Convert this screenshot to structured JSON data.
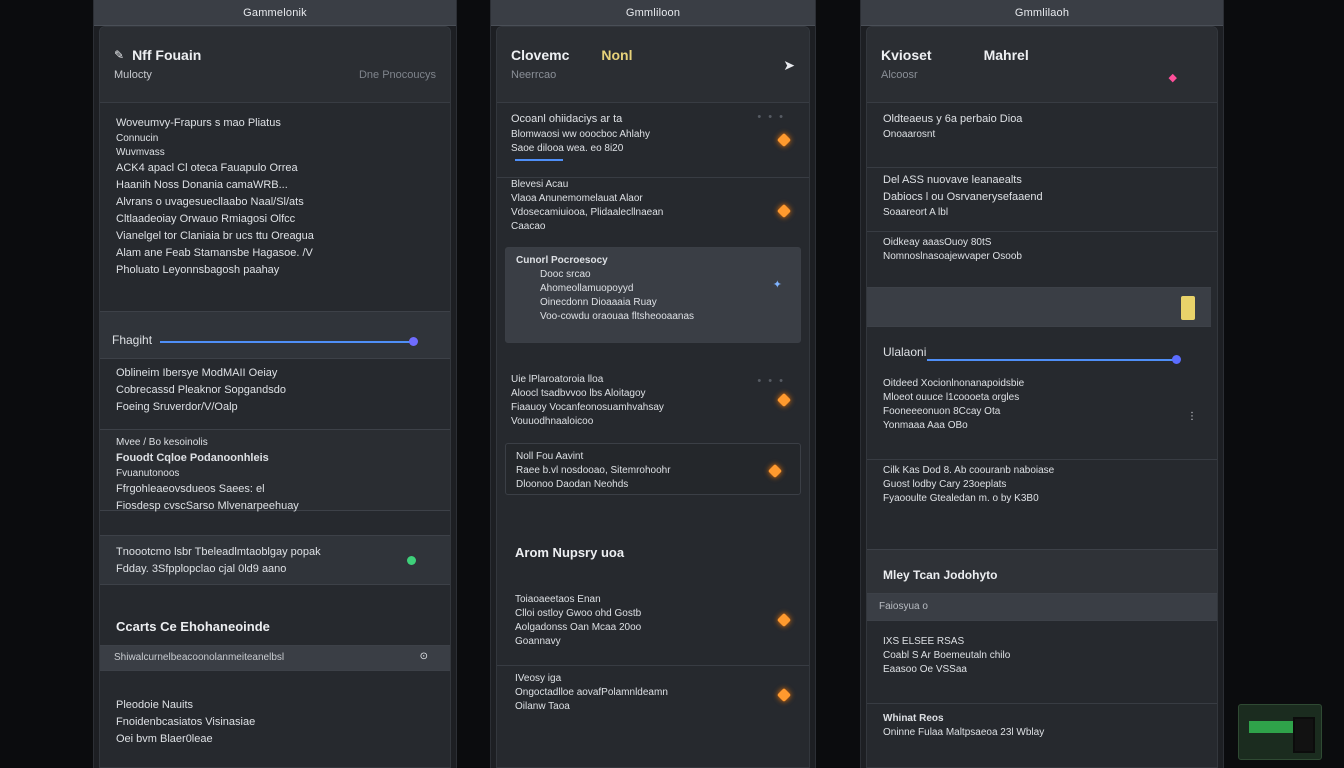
{
  "colors": {
    "bg": "#0b0c0e",
    "panel": "#26292e",
    "accent_blue": "#4f8ff7",
    "accent_green": "#8cf06a",
    "accent_orange": "#ff9a2e"
  },
  "col1": {
    "tab": "Gammelonik",
    "title": "Nff Fouain",
    "subtitle_left": "Mulocty",
    "subtitle_right": "Dne Pnocoucys",
    "block1": [
      "Woveumvy-Frapurs s mao Pliatus",
      "Connucin",
      "Wuvmvass",
      "ACK4 apacl Cl oteca Fauapulo Orrea",
      "Haanih Noss Donania camaWRB...",
      "Alvrans o uvagesuecllaabo Naal/Sl/ats",
      "Cltlaadeoiay Orwauo Rmiagosi Olfcc",
      "Vianelgel tor Claniaia br ucs ttu Oreagua",
      "Alam ane Feab Stamansbe Hagasoe. /V",
      "Pholuato Leyonnsbagosh paahay"
    ],
    "slider_label": "Fhagiht",
    "block2": [
      "Oblineim Ibersye ModMAII Oeiay",
      "Cobrecassd Pleaknor Sopgandsdo",
      "Foeing Sruverdor/V/Oalp"
    ],
    "block3_head": "Mvee / Bo kesoinolis",
    "block3_green": "Fouodt Cqloe Podanoonhleis",
    "block3": [
      "Fvuanutonoos",
      "Ffrgohleaeovsdueos Saees: el",
      "Fiosdesp cvscSarso Mlvenarpeehuay"
    ],
    "block4": [
      "Tnoootcmo lsbr Tbeleadlmtaoblgay popak",
      "Fdday. 3Sfpplopclao cjal 0ld9 aano"
    ],
    "section_title": "Ccarts Ce Ehohaneoinde",
    "search": "Shiwalcurnelbeacoonolanmeiteanelbsl",
    "footer": [
      "Pleodoie Nauits",
      "Fnoidenbcasiatos Visinasiae",
      "Oei bvm Blaer0leae"
    ]
  },
  "col2": {
    "tab": "Gmmliloon",
    "title": "Clovemc",
    "title_accent": "Nonl",
    "subtitle": "Neerrcao",
    "items": [
      {
        "l1": "Ocoanl ohiidaciys ar ta",
        "l2": "Blomwaosi ww ooocboc Ahlahy",
        "l3": "Saoe dilooa wea. eo 8i20"
      },
      {
        "l1": "Blevesi Acau",
        "l2": "Vlaoa Anunemomelauat Alaor",
        "l3": "Vdosecamiuiooa, Plidaalecllnaean",
        "l4": "Caacao"
      },
      {
        "l1": "Cunorl Pocroesocy",
        "l2": "Dooc srcao",
        "l3": "Ahomeollamuopoyyd",
        "l4": "Oinecdonn Dioaaaia Ruay",
        "l5": "Voo-cowdu oraouaa fltsheooaanas"
      },
      {
        "l1": "Uie lPlaroatoroia lloa",
        "l2": "Aloocl tsadbvvoo lbs Aloitagoy",
        "l3": "Fiaauoy Vocanfeonosuamhvahsay",
        "l4": "Vouuodhnaaloicoo"
      },
      {
        "l1": "Noll Fou Aavint",
        "l2": "Raee b.vl nosdooao, Sitemrohoohr",
        "l3": "Dloonoo  Daodan Neohds"
      }
    ],
    "section": "Arom Nupsry uoa",
    "items2": [
      {
        "l1": "Toiaoaeetaos Enan",
        "l2": "Clloi ostloy Gwoo ohd Gostb",
        "l3": "Aolgadonss Oan Mcaa 20oo",
        "l4": "Goannavy"
      },
      {
        "l1": "IVeosy iga",
        "l2": "Ongoctadlloe aovafPolamnldeamn",
        "l3": "Oilanw Taoa"
      }
    ]
  },
  "col3": {
    "tab": "Gmmlilaoh",
    "title": "Kvioset",
    "title2": "Mahrel",
    "subtitle": "Alcoosr",
    "b1": [
      "Oldteaeus y 6a perbaio Dioa",
      "Onoaarosnt"
    ],
    "b2": [
      "Del ASS nuovave leanaealts",
      "Dabiocs l ou Osrvanerysefaaend",
      "Soaareort A lbl"
    ],
    "b3": [
      "Oidkeay aaasOuoy 80tS",
      "Nomnoslnasoajewvaper Osoob"
    ],
    "slider_label": "Ulalaoni",
    "b4": [
      "Oitdeed Xocionlnonanapoidsbie",
      "Mloeot ouuce l1coooeta orgles",
      "Fooneeeonuon 8Ccay Ota",
      "Yonmaaa   Aaa OBo"
    ],
    "b5": [
      "Cilk Kas Dod 8. Ab coouranb naboiase",
      "Guost lodby Cary 23oeplats",
      "Fyaooulte Gtealedan m. o by K3B0"
    ],
    "section": "Mley Tcan Jodohyto",
    "search": "Faiosyua o",
    "b6": [
      "IXS ELSEE RSAS",
      "Coabl S Ar Boemeutaln chilo",
      "Eaasoo Oe VSSaa"
    ],
    "footer_head": "Whinat Reos",
    "footer": "Oninne Fulaa Maltpsaeoa 23l Wblay"
  }
}
